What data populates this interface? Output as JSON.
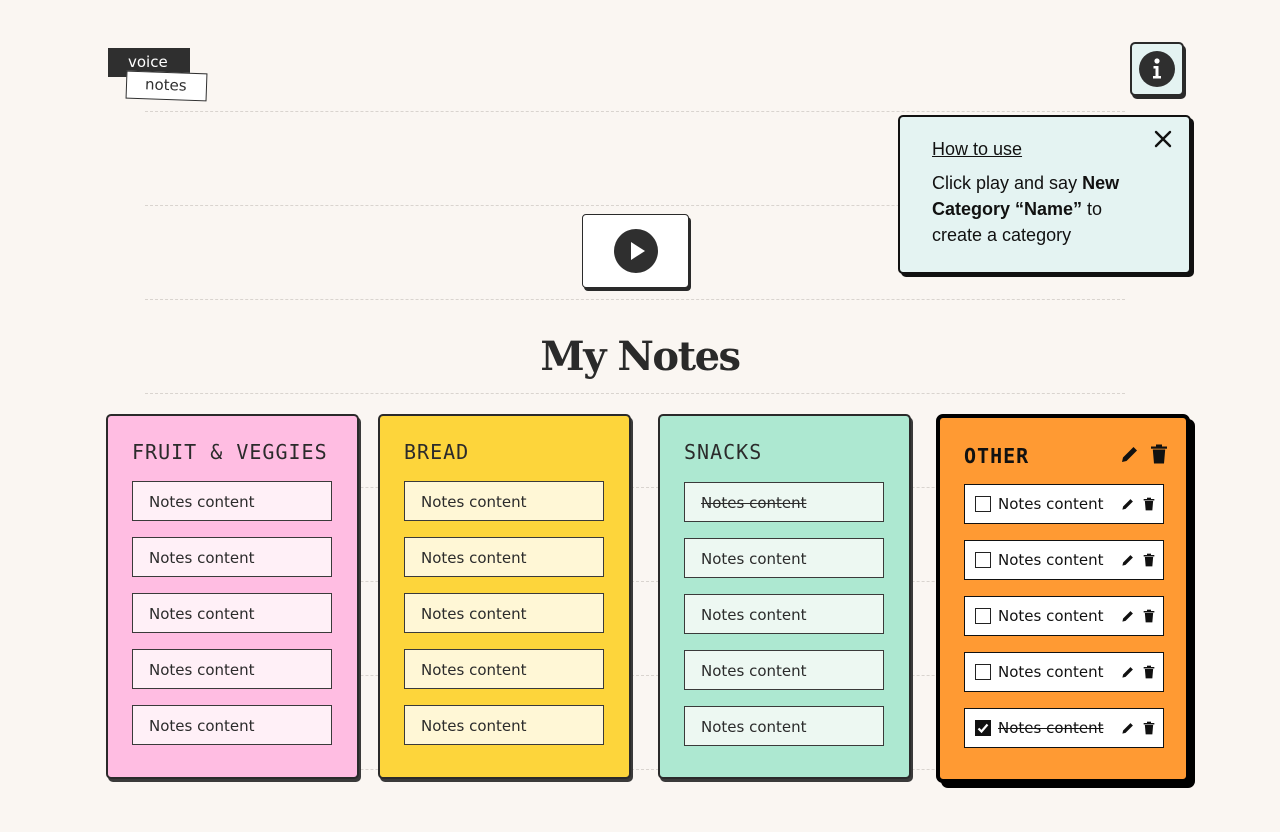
{
  "logo": {
    "top": "voice",
    "bottom": "notes"
  },
  "info_button": {
    "icon": "info-icon"
  },
  "help": {
    "title": "How to use",
    "text_before": "Click play and say ",
    "text_bold": "New Category “Name”",
    "text_after": " to create a category"
  },
  "play_button": {
    "icon": "play-icon"
  },
  "page_title": "My Notes",
  "colors": {
    "fruit": "#ffbde2",
    "fruit_note": "#fff0f7",
    "bread": "#fdd53b",
    "bread_note": "#fff7d6",
    "snacks": "#ade8d1",
    "snacks_note": "#edf8f2",
    "other": "#ff9a33"
  },
  "categories": [
    {
      "title": "FRUIT & VEGGIES",
      "notes": [
        {
          "text": "Notes content",
          "done": false
        },
        {
          "text": "Notes content",
          "done": false
        },
        {
          "text": "Notes content",
          "done": false
        },
        {
          "text": "Notes content",
          "done": false
        },
        {
          "text": "Notes content",
          "done": false
        }
      ]
    },
    {
      "title": "BREAD",
      "notes": [
        {
          "text": "Notes content",
          "done": false
        },
        {
          "text": "Notes content",
          "done": false
        },
        {
          "text": "Notes content",
          "done": false
        },
        {
          "text": "Notes content",
          "done": false
        },
        {
          "text": "Notes content",
          "done": false
        }
      ]
    },
    {
      "title": "SNACKS",
      "notes": [
        {
          "text": "Notes content",
          "done": true
        },
        {
          "text": "Notes content",
          "done": false
        },
        {
          "text": "Notes content",
          "done": false
        },
        {
          "text": "Notes content",
          "done": false
        },
        {
          "text": "Notes content",
          "done": false
        }
      ]
    },
    {
      "title": "OTHER",
      "actions": [
        "edit-icon",
        "trash-icon"
      ],
      "notes": [
        {
          "text": "Notes content",
          "done": false
        },
        {
          "text": "Notes content",
          "done": false
        },
        {
          "text": "Notes content",
          "done": false
        },
        {
          "text": "Notes content",
          "done": false
        },
        {
          "text": "Notes content",
          "done": true
        }
      ]
    }
  ]
}
